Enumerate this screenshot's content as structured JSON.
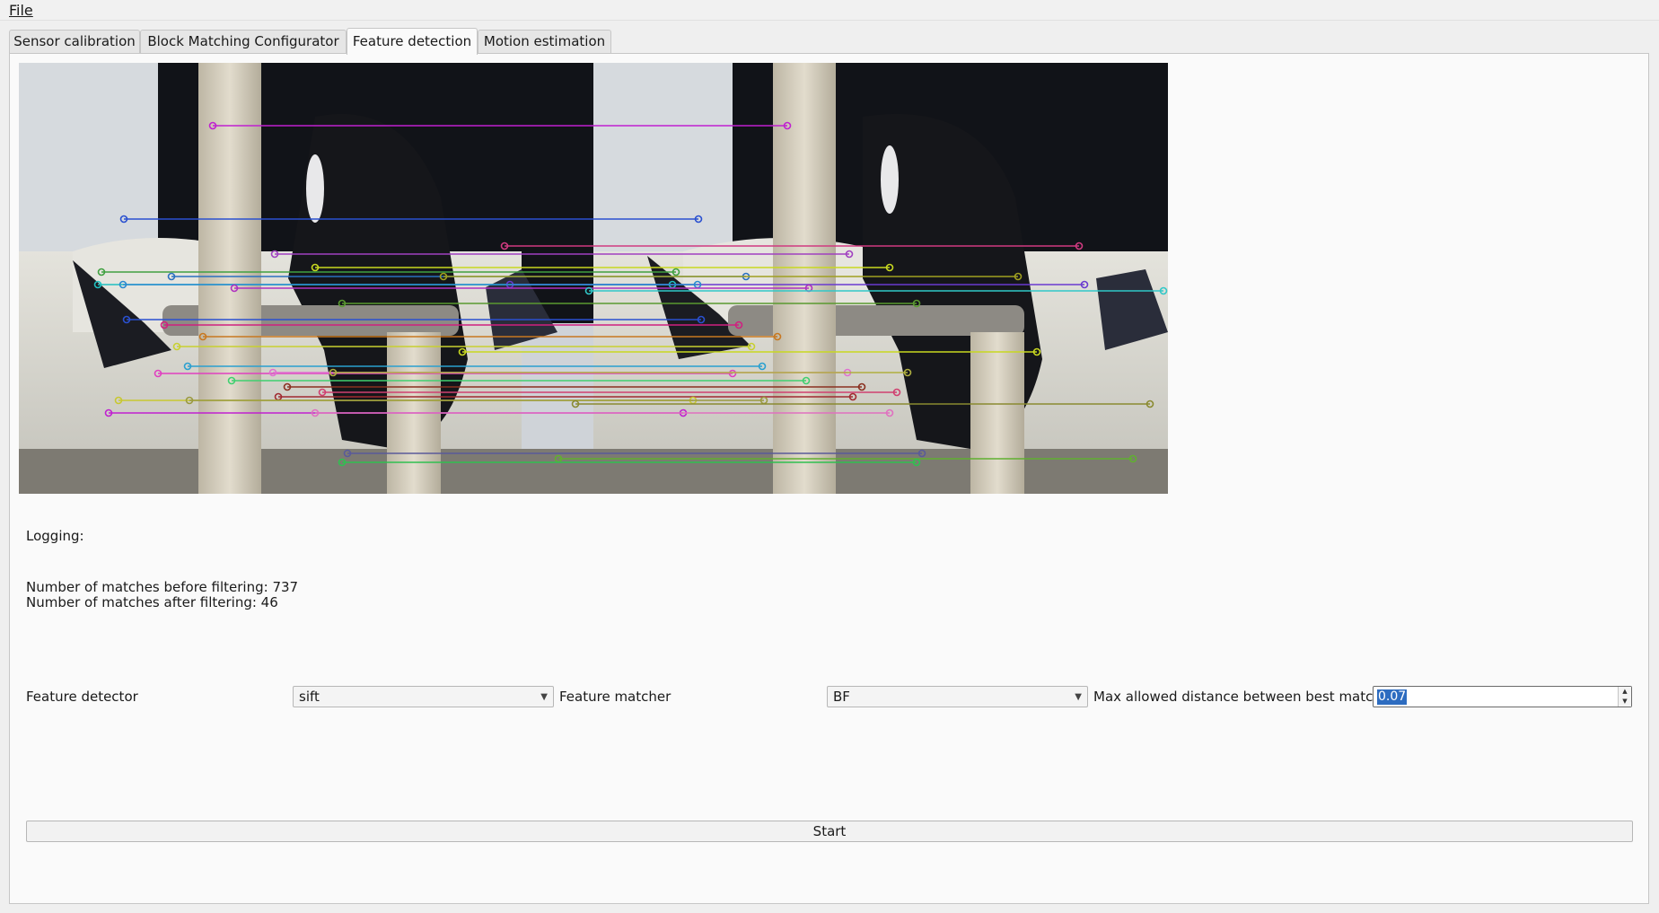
{
  "menubar": {
    "file_label": "File"
  },
  "tabs": [
    {
      "label": "Sensor calibration"
    },
    {
      "label": "Block Matching Configurator"
    },
    {
      "label": "Feature detection",
      "active": true
    },
    {
      "label": "Motion estimation"
    }
  ],
  "logging": {
    "label": "Logging:",
    "matches_before": "Number of matches before filtering: 737",
    "matches_after": "Number of matches after filtering: 46"
  },
  "controls": {
    "feature_detector_label": "Feature detector",
    "feature_detector_value": "sift",
    "feature_matcher_label": "Feature matcher",
    "feature_matcher_value": "BF",
    "max_distance_label": "Max allowed distance between best matches",
    "max_distance_value": "0.07",
    "start_label": "Start"
  },
  "colors": {
    "accent": "#2d6cc0",
    "match_colors": [
      "#c020d0",
      "#2a50d0",
      "#d03a80",
      "#9a9a40",
      "#20c0c0",
      "#a040c0",
      "#c8d820",
      "#d040b0",
      "#40d070",
      "#8a3020"
    ]
  }
}
